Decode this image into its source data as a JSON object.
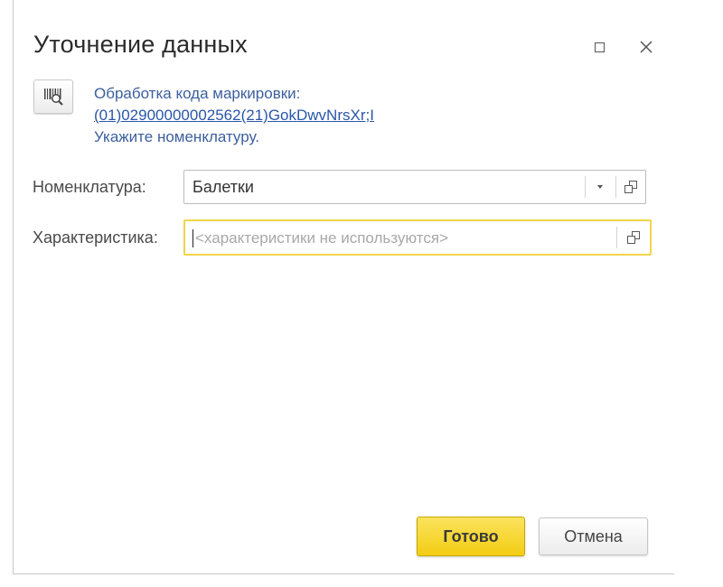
{
  "window": {
    "title": "Уточнение данных",
    "maximize_icon": "maximize-icon",
    "close_icon": "close-icon"
  },
  "info": {
    "barcode_icon": "barcode-scan-icon",
    "line1": "Обработка кода маркировки:",
    "code": "(01)02900000002562(21)GokDwvNrsXr;I",
    "line3": "Укажите номенклатуру."
  },
  "form": {
    "nomenclature": {
      "label": "Номенклатура:",
      "value": "Балетки"
    },
    "characteristic": {
      "label": "Характеристика:",
      "value": "",
      "placeholder": "<характеристики не используются>"
    }
  },
  "buttons": {
    "ok_label": "Готово",
    "cancel_label": "Отмена"
  },
  "colors": {
    "link": "#2a57a8",
    "info_text": "#3c5f9e",
    "primary_button": "#f3cd12",
    "focus_border": "#f0d44a"
  }
}
